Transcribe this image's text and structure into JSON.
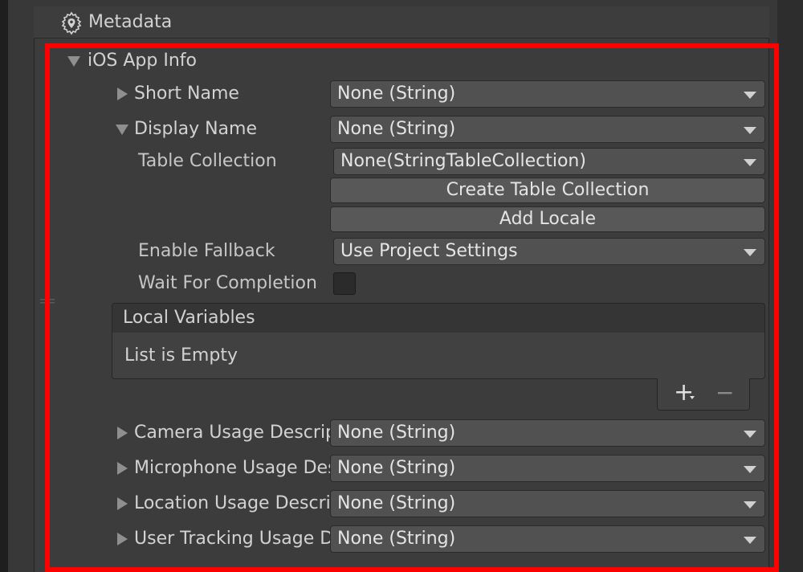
{
  "header": {
    "title": "Metadata",
    "icon": "settings-location-icon"
  },
  "ios_app_info": {
    "label": "iOS App Info",
    "fields": {
      "short_name": {
        "label": "Short Name",
        "value": "None (String)"
      },
      "display_name": {
        "label": "Display Name",
        "value": "None (String)",
        "table_collection": {
          "label": "Table Collection",
          "value": "None(StringTableCollection)"
        },
        "create_button": "Create Table Collection",
        "add_locale_button": "Add Locale",
        "enable_fallback": {
          "label": "Enable Fallback",
          "value": "Use Project Settings"
        },
        "wait_for_completion": {
          "label": "Wait For Completion",
          "checked": false
        },
        "local_variables": {
          "header": "Local Variables",
          "empty_text": "List is Empty",
          "add_symbol": "+",
          "remove_symbol": "−"
        }
      },
      "camera": {
        "label": "Camera Usage Description",
        "value": "None (String)"
      },
      "microphone": {
        "label": "Microphone Usage Description",
        "value": "None (String)"
      },
      "location": {
        "label": "Location Usage Description",
        "value": "None (String)"
      },
      "user_tracking": {
        "label": "User Tracking Usage Description",
        "value": "None (String)"
      }
    }
  },
  "colors": {
    "highlight": "#ff0000",
    "background": "#383838",
    "field": "#515151"
  }
}
